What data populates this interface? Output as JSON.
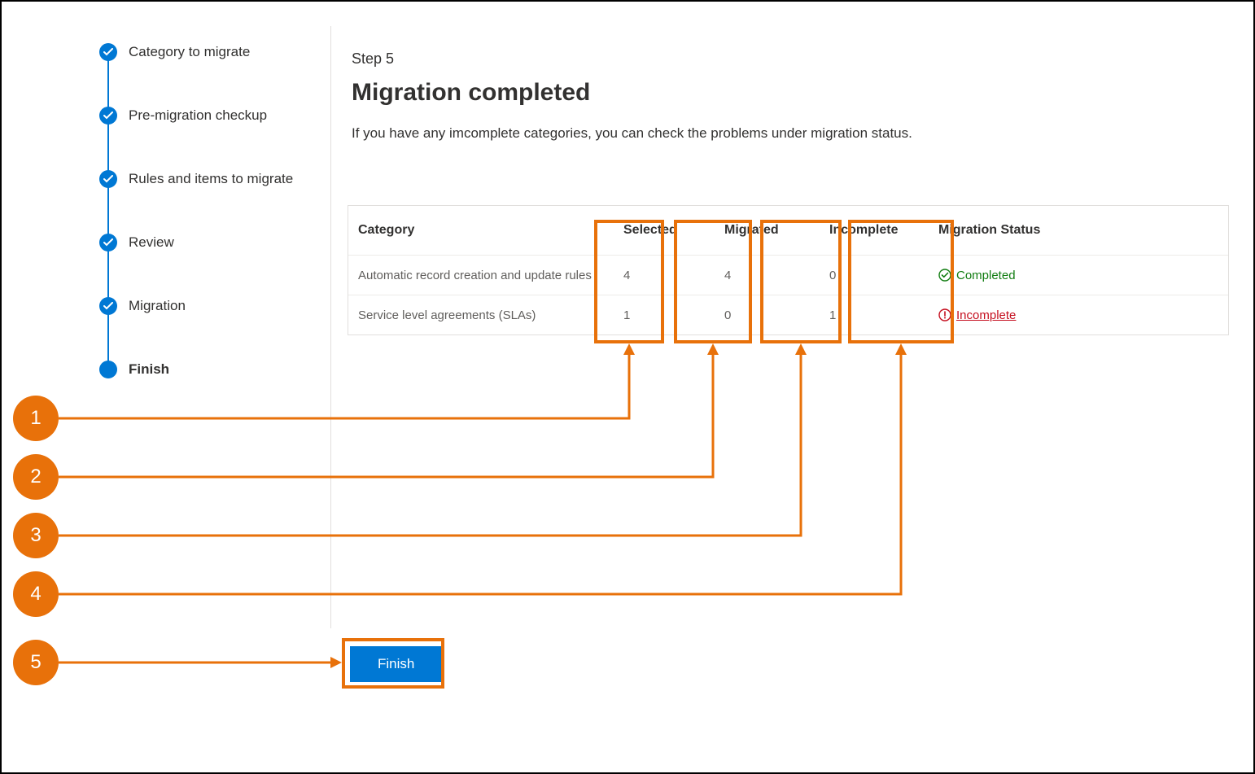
{
  "stepper": {
    "items": [
      {
        "label": "Category to migrate"
      },
      {
        "label": "Pre-migration checkup"
      },
      {
        "label": "Rules and items to migrate"
      },
      {
        "label": "Review"
      },
      {
        "label": "Migration"
      },
      {
        "label": "Finish"
      }
    ]
  },
  "main": {
    "kicker": "Step 5",
    "title": "Migration completed",
    "description": "If you have any imcomplete categories, you can check the problems under migration status."
  },
  "table": {
    "headers": {
      "category": "Category",
      "selected": "Selected",
      "migrated": "Migrated",
      "incomplete": "Incomplete",
      "status": "Migration Status"
    },
    "rows": [
      {
        "category": "Automatic record creation and update rules",
        "selected": "4",
        "migrated": "4",
        "incomplete": "0",
        "status": "Completed",
        "statusKind": "completed"
      },
      {
        "category": "Service level agreements (SLAs)",
        "selected": "1",
        "migrated": "0",
        "incomplete": "1",
        "status": "Incomplete",
        "statusKind": "incomplete"
      }
    ]
  },
  "finish": {
    "label": "Finish"
  },
  "annotations": {
    "n1": "1",
    "n2": "2",
    "n3": "3",
    "n4": "4",
    "n5": "5"
  }
}
